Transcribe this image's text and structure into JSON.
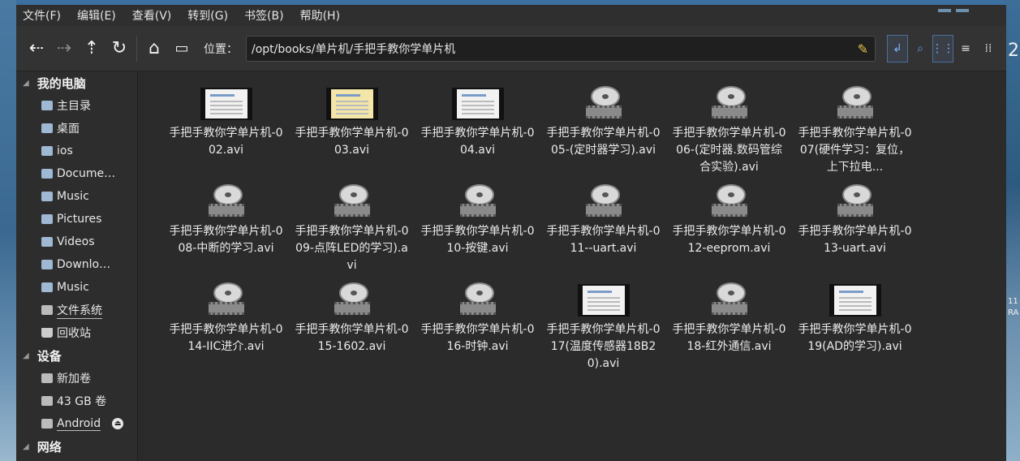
{
  "menu": [
    "文件(F)",
    "编辑(E)",
    "查看(V)",
    "转到(G)",
    "书签(B)",
    "帮助(H)"
  ],
  "toolbar": {
    "back_icon": "arrow-left-icon",
    "forward_icon": "arrow-right-icon",
    "up_icon": "arrow-up-icon",
    "reload_icon": "reload-icon",
    "home_icon": "home-icon",
    "computer_icon": "computer-icon",
    "location_label": "位置：",
    "path": "/opt/books/单片机/手把手教你学单片机"
  },
  "sidebar": {
    "sections": [
      {
        "title": "我的电脑",
        "items": [
          {
            "label": "主目录",
            "icon": "home-folder-icon"
          },
          {
            "label": "桌面",
            "icon": "desktop-folder-icon"
          },
          {
            "label": "ios",
            "icon": "folder-icon"
          },
          {
            "label": "Docume…",
            "icon": "documents-folder-icon"
          },
          {
            "label": "Music",
            "icon": "music-folder-icon"
          },
          {
            "label": "Pictures",
            "icon": "pictures-folder-icon"
          },
          {
            "label": "Videos",
            "icon": "videos-folder-icon"
          },
          {
            "label": "Downlo…",
            "icon": "downloads-folder-icon"
          },
          {
            "label": "Music",
            "icon": "folder-icon"
          },
          {
            "label": "文件系统",
            "icon": "drive-icon"
          },
          {
            "label": "回收站",
            "icon": "trash-icon"
          }
        ]
      },
      {
        "title": "设备",
        "items": [
          {
            "label": "新加卷",
            "icon": "drive-icon"
          },
          {
            "label": "43 GB 卷",
            "icon": "drive-icon"
          },
          {
            "label": "Android",
            "icon": "phone-icon"
          }
        ]
      },
      {
        "title": "网络",
        "items": []
      }
    ]
  },
  "files": [
    {
      "name": "手把手教你学单片机-002.avi",
      "thumb": "video"
    },
    {
      "name": "手把手教你学单片机-003.avi",
      "thumb": "video-yellow"
    },
    {
      "name": "手把手教你学单片机-004.avi",
      "thumb": "video"
    },
    {
      "name": "手把手教你学单片机-005-(定时器学习).avi",
      "thumb": "reel"
    },
    {
      "name": "手把手教你学单片机-006-(定时器.数码管综合实验).avi",
      "thumb": "reel"
    },
    {
      "name": "手把手教你学单片机-007(硬件学习：复位，上下拉电...",
      "thumb": "reel"
    },
    {
      "name": "手把手教你学单片机-008-中断的学习.avi",
      "thumb": "reel"
    },
    {
      "name": "手把手教你学单片机-009-点阵LED的学习).avi",
      "thumb": "reel"
    },
    {
      "name": "手把手教你学单片机-010-按键.avi",
      "thumb": "reel"
    },
    {
      "name": "手把手教你学单片机-011--uart.avi",
      "thumb": "reel"
    },
    {
      "name": "手把手教你学单片机-012-eeprom.avi",
      "thumb": "reel"
    },
    {
      "name": "手把手教你学单片机-013-uart.avi",
      "thumb": "reel"
    },
    {
      "name": "手把手教你学单片机-014-IIC进介.avi",
      "thumb": "reel"
    },
    {
      "name": "手把手教你学单片机-015-1602.avi",
      "thumb": "reel"
    },
    {
      "name": "手把手教你学单片机-016-时钟.avi",
      "thumb": "reel"
    },
    {
      "name": "手把手教你学单片机-017(温度传感器18B20).avi",
      "thumb": "video-dark"
    },
    {
      "name": "手把手教你学单片机-018-红外通信.avi",
      "thumb": "reel"
    },
    {
      "name": "手把手教你学单片机-019(AD的学习).avi",
      "thumb": "video"
    }
  ],
  "desktop": {
    "digit": "2",
    "time": "11",
    "ra": "RA"
  },
  "colors": {
    "accent": "#3a6fa0",
    "window_bg": "#2b2b2b"
  }
}
